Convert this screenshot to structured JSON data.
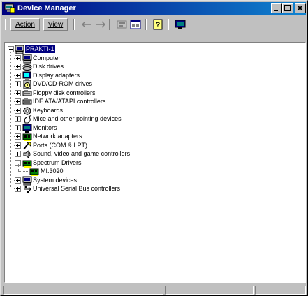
{
  "window": {
    "title": "Device Manager"
  },
  "menu": {
    "action": "Action",
    "view": "View"
  },
  "toolbar_icons": [
    "back-arrow-icon",
    "forward-arrow-icon",
    "properties-icon",
    "view-icon",
    "help-icon",
    "monitor-icon"
  ],
  "tree": {
    "root": "PRAKTI-1",
    "items": [
      {
        "label": "Computer",
        "icon": "computer-icon",
        "expanded": false
      },
      {
        "label": "Disk drives",
        "icon": "disk-drive-icon",
        "expanded": false
      },
      {
        "label": "Display adapters",
        "icon": "display-adapter-icon",
        "expanded": false
      },
      {
        "label": "DVD/CD-ROM drives",
        "icon": "cdrom-icon",
        "expanded": false
      },
      {
        "label": "Floppy disk controllers",
        "icon": "controller-icon",
        "expanded": false
      },
      {
        "label": "IDE ATA/ATAPI controllers",
        "icon": "controller-icon",
        "expanded": false
      },
      {
        "label": "Keyboards",
        "icon": "keyboard-icon",
        "expanded": false
      },
      {
        "label": "Mice and other pointing devices",
        "icon": "mouse-icon",
        "expanded": false
      },
      {
        "label": "Monitors",
        "icon": "monitor-icon",
        "expanded": false
      },
      {
        "label": "Network adapters",
        "icon": "network-adapter-icon",
        "expanded": false
      },
      {
        "label": "Ports (COM & LPT)",
        "icon": "port-icon",
        "expanded": false
      },
      {
        "label": "Sound, video and game controllers",
        "icon": "sound-icon",
        "expanded": false
      },
      {
        "label": "Spectrum Drivers",
        "icon": "board-icon",
        "expanded": true,
        "children": [
          {
            "label": "MI.3020",
            "icon": "board-icon"
          }
        ]
      },
      {
        "label": "System devices",
        "icon": "computer-icon",
        "expanded": false
      },
      {
        "label": "Universal Serial Bus controllers",
        "icon": "usb-icon",
        "expanded": false
      }
    ]
  }
}
